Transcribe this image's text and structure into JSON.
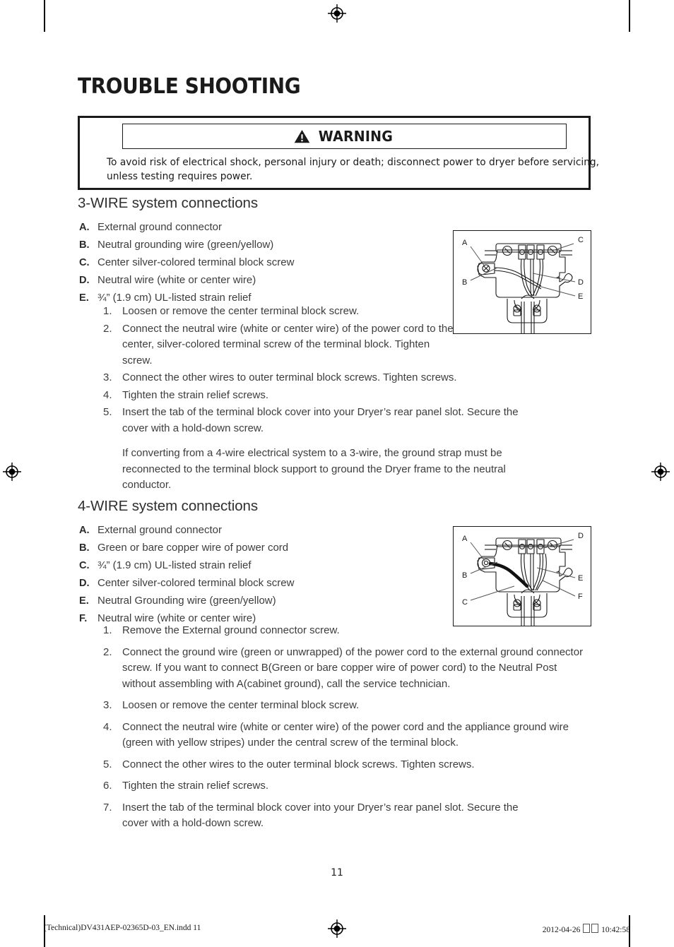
{
  "document": {
    "title": "TROUBLE SHOOTING",
    "page_number": "11"
  },
  "warning": {
    "icon": "warning-triangle-icon",
    "label": "WARNING",
    "text": "To avoid risk of electrical shock, personal injury or death; disconnect power to dryer before servicing, unless testing requires power."
  },
  "sections": [
    {
      "heading": "3-WIRE system connections",
      "parts": [
        {
          "marker": "A.",
          "text": "External ground connector"
        },
        {
          "marker": "B.",
          "text": "Neutral grounding wire (green/yellow)"
        },
        {
          "marker": "C.",
          "text": "Center silver-colored terminal block screw"
        },
        {
          "marker": "D.",
          "text": "Neutral wire (white or center wire)"
        },
        {
          "marker": "E.",
          "text": "¾” (1.9 cm) UL-listed strain relief"
        }
      ],
      "steps": [
        {
          "marker": "1.",
          "text": "Loosen or remove the center terminal block screw."
        },
        {
          "marker": "2.",
          "text": "Connect the neutral wire (white or center wire) of the power cord to the center, silver-colored terminal screw of the terminal block. Tighten screw."
        },
        {
          "marker": "3.",
          "text": "Connect the other wires to outer terminal block screws. Tighten screws."
        },
        {
          "marker": "4.",
          "text": "Tighten the strain relief screws."
        },
        {
          "marker": "5.",
          "text": "Insert the tab of the terminal block cover into your Dryer’s rear panel slot. Secure the cover with a hold-down screw."
        }
      ],
      "note": "If converting from a 4-wire electrical system to a 3-wire, the ground strap must be reconnected to the terminal block support to ground the Dryer frame to the neutral conductor.",
      "diagram": {
        "name": "three-wire-terminal-block-diagram",
        "callouts": [
          "A",
          "B",
          "C",
          "D",
          "E"
        ]
      }
    },
    {
      "heading": "4-WIRE system connections",
      "parts": [
        {
          "marker": "A.",
          "text": "External ground connector"
        },
        {
          "marker": "B.",
          "text": "Green or bare copper wire of power cord"
        },
        {
          "marker": "C.",
          "text": "¾” (1.9 cm) UL-listed strain relief"
        },
        {
          "marker": "D.",
          "text": "Center silver-colored terminal block screw"
        },
        {
          "marker": "E.",
          "text": "Neutral Grounding wire (green/yellow)"
        },
        {
          "marker": "F.",
          "text": "Neutral wire (white or center wire)"
        }
      ],
      "steps": [
        {
          "marker": "1.",
          "text": "Remove the External ground connector screw."
        },
        {
          "marker": "2.",
          "text": "Connect the ground wire (green or unwrapped) of the power cord to the external ground connector screw. If you want to connect B(Green or bare copper wire of power cord) to the Neutral Post without assembling with A(cabinet ground), call the service technician."
        },
        {
          "marker": "3.",
          "text": "Loosen or remove the center terminal block screw."
        },
        {
          "marker": "4.",
          "text": "Connect the neutral wire (white or center wire) of the power cord and the appliance ground wire (green with yellow stripes) under the central screw of the terminal block."
        },
        {
          "marker": "5.",
          "text": "Connect the other wires to the outer terminal block screws. Tighten screws."
        },
        {
          "marker": "6.",
          "text": "Tighten the strain relief screws."
        },
        {
          "marker": "7.",
          "text": "Insert the tab of the terminal block cover into your Dryer’s rear panel slot. Secure the cover with a hold-down screw."
        }
      ],
      "diagram": {
        "name": "four-wire-terminal-block-diagram",
        "callouts": [
          "A",
          "B",
          "C",
          "D",
          "E",
          "F"
        ]
      }
    }
  ],
  "footer": {
    "file_label": "(Technical)DV431AEP-02365D-03_EN.indd   11",
    "date": "2012-04-26",
    "time": "10:42:58"
  },
  "colors": {
    "ink": "#1a1a1a",
    "body_text": "#3d3d3d",
    "rule": "#1a1a1a"
  }
}
